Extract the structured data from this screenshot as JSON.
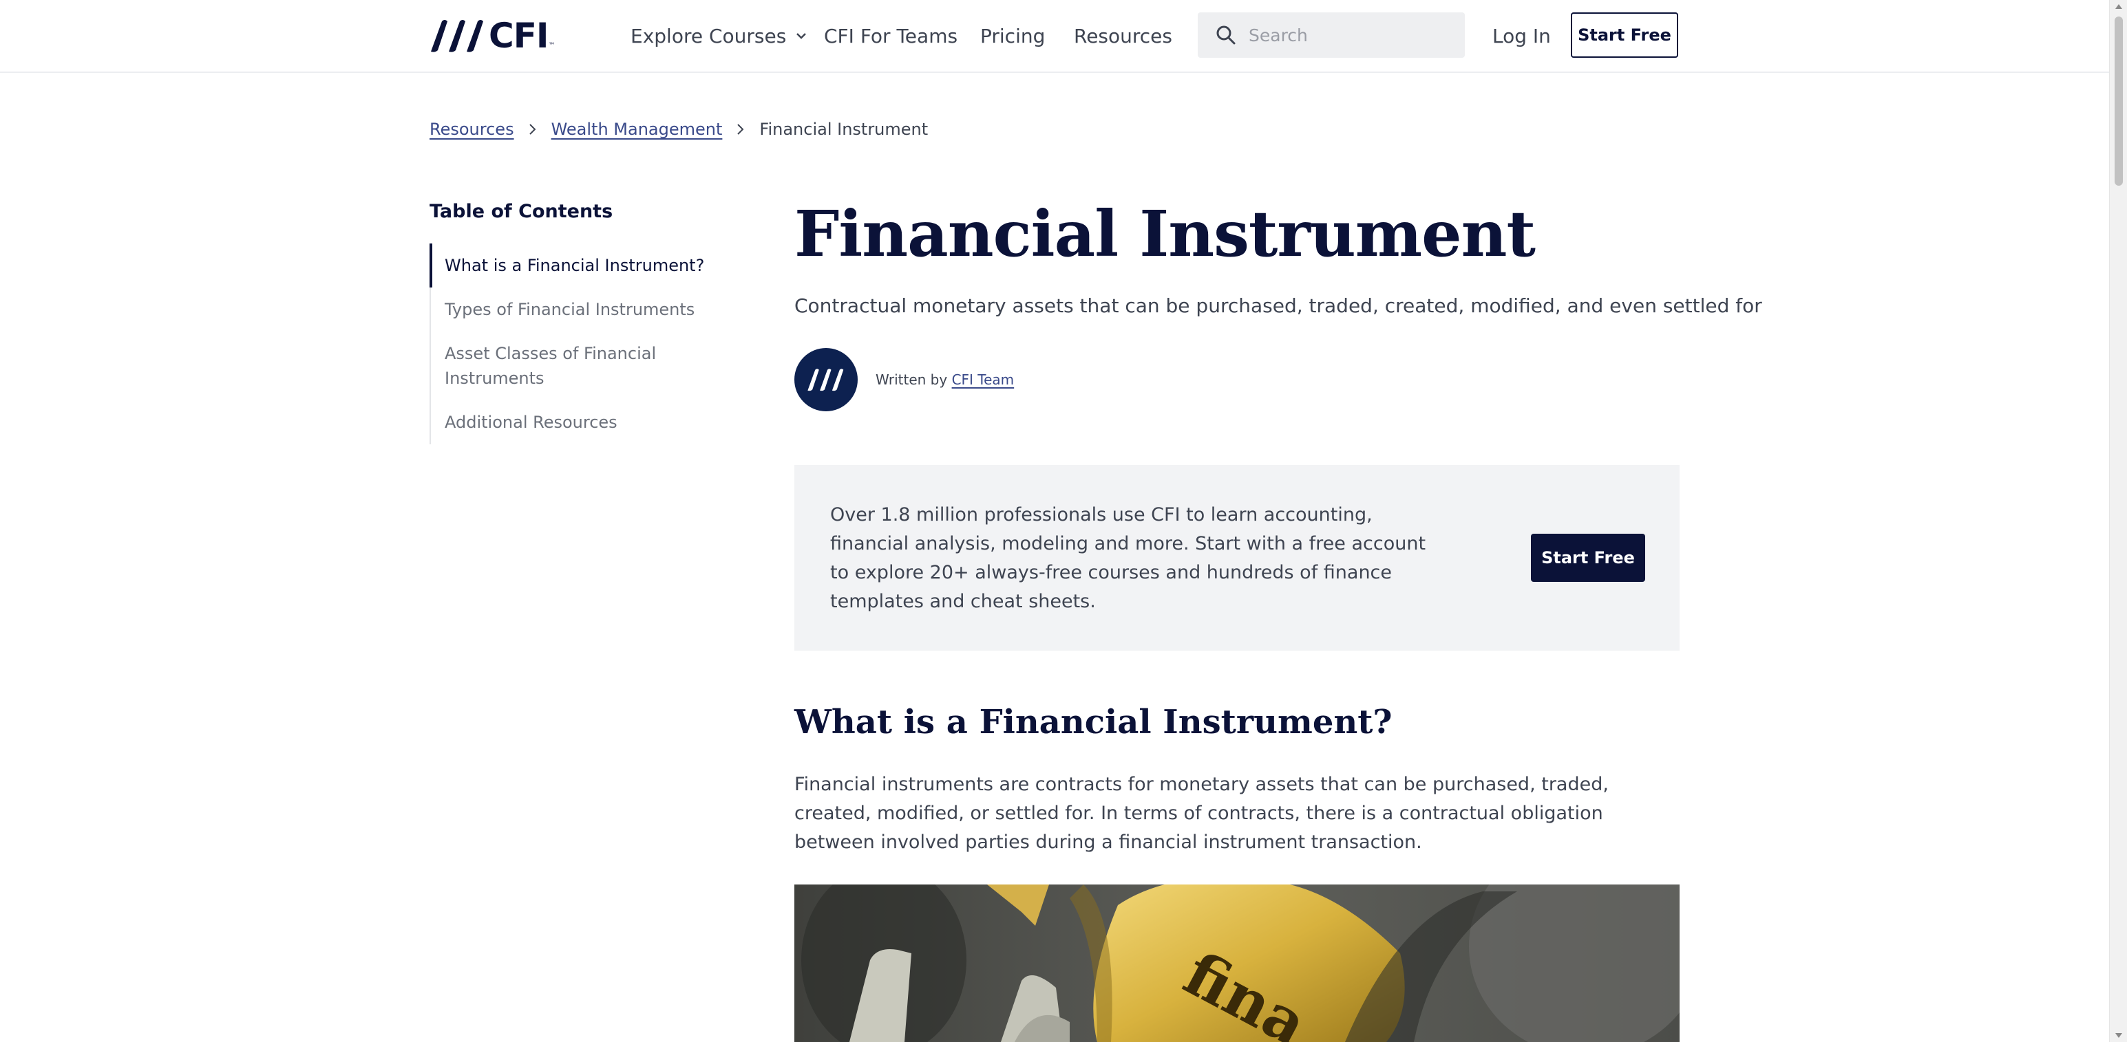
{
  "header": {
    "logo_text": "CFI",
    "logo_tm": "™",
    "nav": [
      {
        "label": "Explore Courses"
      },
      {
        "label": "CFI For Teams"
      },
      {
        "label": "Pricing"
      },
      {
        "label": "Resources"
      }
    ],
    "search": {
      "placeholder": "Search",
      "icon": "search-icon"
    },
    "login_label": "Log In",
    "start_free_label": "Start Free"
  },
  "breadcrumb": {
    "items": [
      "Resources",
      "Wealth Management",
      "Financial Instrument"
    ]
  },
  "toc": {
    "title": "Table of Contents",
    "items": [
      "What is a Financial Instrument?",
      "Types of Financial Instruments",
      "Asset Classes of Financial Instruments",
      "Additional Resources"
    ]
  },
  "article": {
    "title": "Financial Instrument",
    "subtitle": "Contractual monetary assets that can be purchased, traded, created, modified, and even settled for",
    "author_prefix": "Written by",
    "author_name": "CFI Team",
    "promo_text": "Over 1.8 million professionals use CFI to learn accounting, financial analysis, modeling and more. Start with a free account to explore 20+ always-free courses and hundreds of finance templates and cheat sheets.",
    "promo_button": "Start Free",
    "section_heading": "What is a Financial Instrument?",
    "section_body": "Financial instruments are contracts for monetary assets that can be purchased, traded, created, modified, or settled for. In terms of contracts, there is a contractual obligation between involved parties during a financial instrument transaction.",
    "image_text": "fina"
  },
  "colors": {
    "brand_navy": "#0b1238",
    "link": "#3a4a8a",
    "promo_bg": "#f2f3f5"
  }
}
